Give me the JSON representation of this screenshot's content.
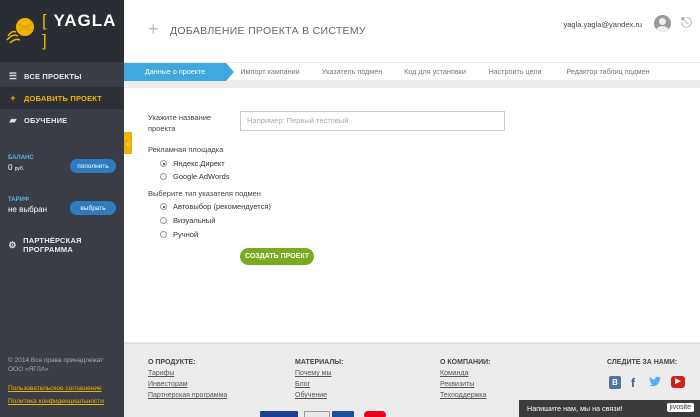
{
  "app": {
    "logo_text": "YAGLA",
    "header_title": "ДОБАВЛЕНИЕ ПРОЕКТА В СИСТЕМУ",
    "user_email": "yagla.yagla@yandex.ru"
  },
  "sidebar": {
    "items": [
      {
        "label": "ВСЕ ПРОЕКТЫ",
        "icon": "list-icon"
      },
      {
        "label": "ДОБАВИТЬ ПРОЕКТ",
        "icon": "plus-icon"
      },
      {
        "label": "ОБУЧЕНИЕ",
        "icon": "graduation-cap-icon"
      }
    ],
    "balance_label": "БАЛАНС",
    "balance_value": "0",
    "balance_unit": "руб.",
    "balance_button": "пополнить",
    "tariff_label": "ТАРИФ",
    "tariff_value": "не выбран",
    "tariff_button": "выбрать",
    "partner_label": "ПАРТНЁРСКАЯ ПРОГРАММА",
    "copyright": "© 2014 Все права принадлежат ООО «ЯГЛА»",
    "agreement_link": "Пользовательское соглашение",
    "privacy_link": "Политика конфиденциальности"
  },
  "steps": [
    "Данные о проекте",
    "Импорт кампании",
    "Указатель подмен",
    "Код для установки",
    "Настроить цели",
    "Редактор таблиц подмен"
  ],
  "form": {
    "name_label_1": "Укажите название",
    "name_label_2": "проекта",
    "name_placeholder": "Например: Первый тестовый",
    "platform_label": "Рекламная площадка",
    "platform_options": [
      "Яндекс.Директ",
      "Google AdWords"
    ],
    "type_label": "Выберите тип указателя подмен",
    "type_options": [
      "Автовыбор (рекомендуется)",
      "Визуальный",
      "Ручной"
    ],
    "create_button": "СОЗДАТЬ ПРОЕКТ"
  },
  "footer": {
    "col1": {
      "head": "О ПРОДУКТЕ:",
      "links": [
        "Тарифы",
        "Инвесторам",
        "Партнерская программа"
      ]
    },
    "col2": {
      "head": "МАТЕРИАЛЫ:",
      "links": [
        "Почему мы",
        "Блог",
        "Обучение"
      ]
    },
    "col3": {
      "head": "О КОМПАНИИ:",
      "links": [
        "Команда",
        "Реквизиты",
        "Техподдержка"
      ]
    },
    "social_head": "СЛЕДИТЕ ЗА НАМИ:",
    "social": {
      "vk": "В",
      "facebook": "f",
      "youtube": "▶"
    }
  },
  "chat": {
    "text": "Напишите нам, мы на связи!",
    "brand": "jivosite"
  },
  "colors": {
    "accent": "#f0b400",
    "step_active": "#3fa8dc",
    "create": "#78ac1e",
    "sidebar": "#3a3d46"
  }
}
